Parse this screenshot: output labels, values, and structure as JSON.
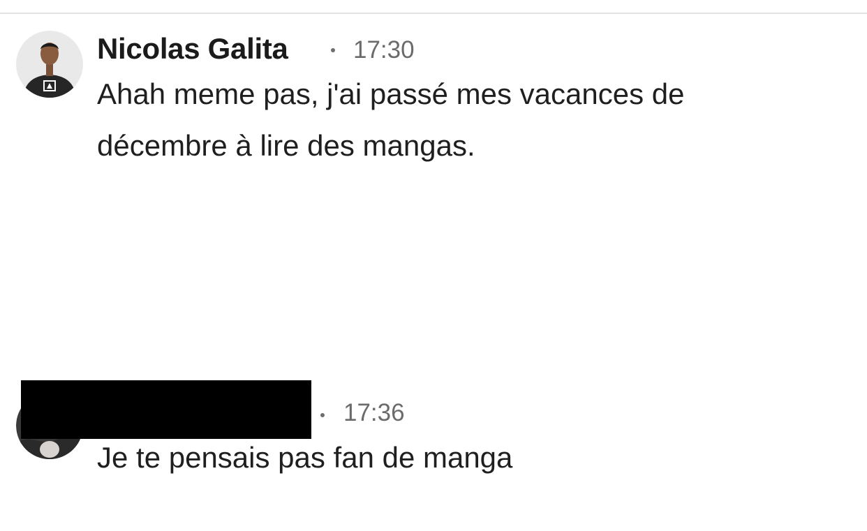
{
  "messages": [
    {
      "sender": "Nicolas Galita",
      "time": "17:30",
      "avatar": "profile-photo",
      "lines": [
        "Ahah meme pas, j'ai passé mes vacances de",
        "décembre à lire des mangas."
      ]
    },
    {
      "sender": "",
      "sender_redacted": true,
      "time": "17:36",
      "avatar": "profile-photo",
      "lines": [
        "Je te pensais pas fan de manga"
      ]
    }
  ],
  "colors": {
    "name": "#1b1b1b",
    "text": "#1f1f1f",
    "time": "#6b6b6b",
    "divider": "#e3e3e3",
    "redaction": "#000000"
  }
}
